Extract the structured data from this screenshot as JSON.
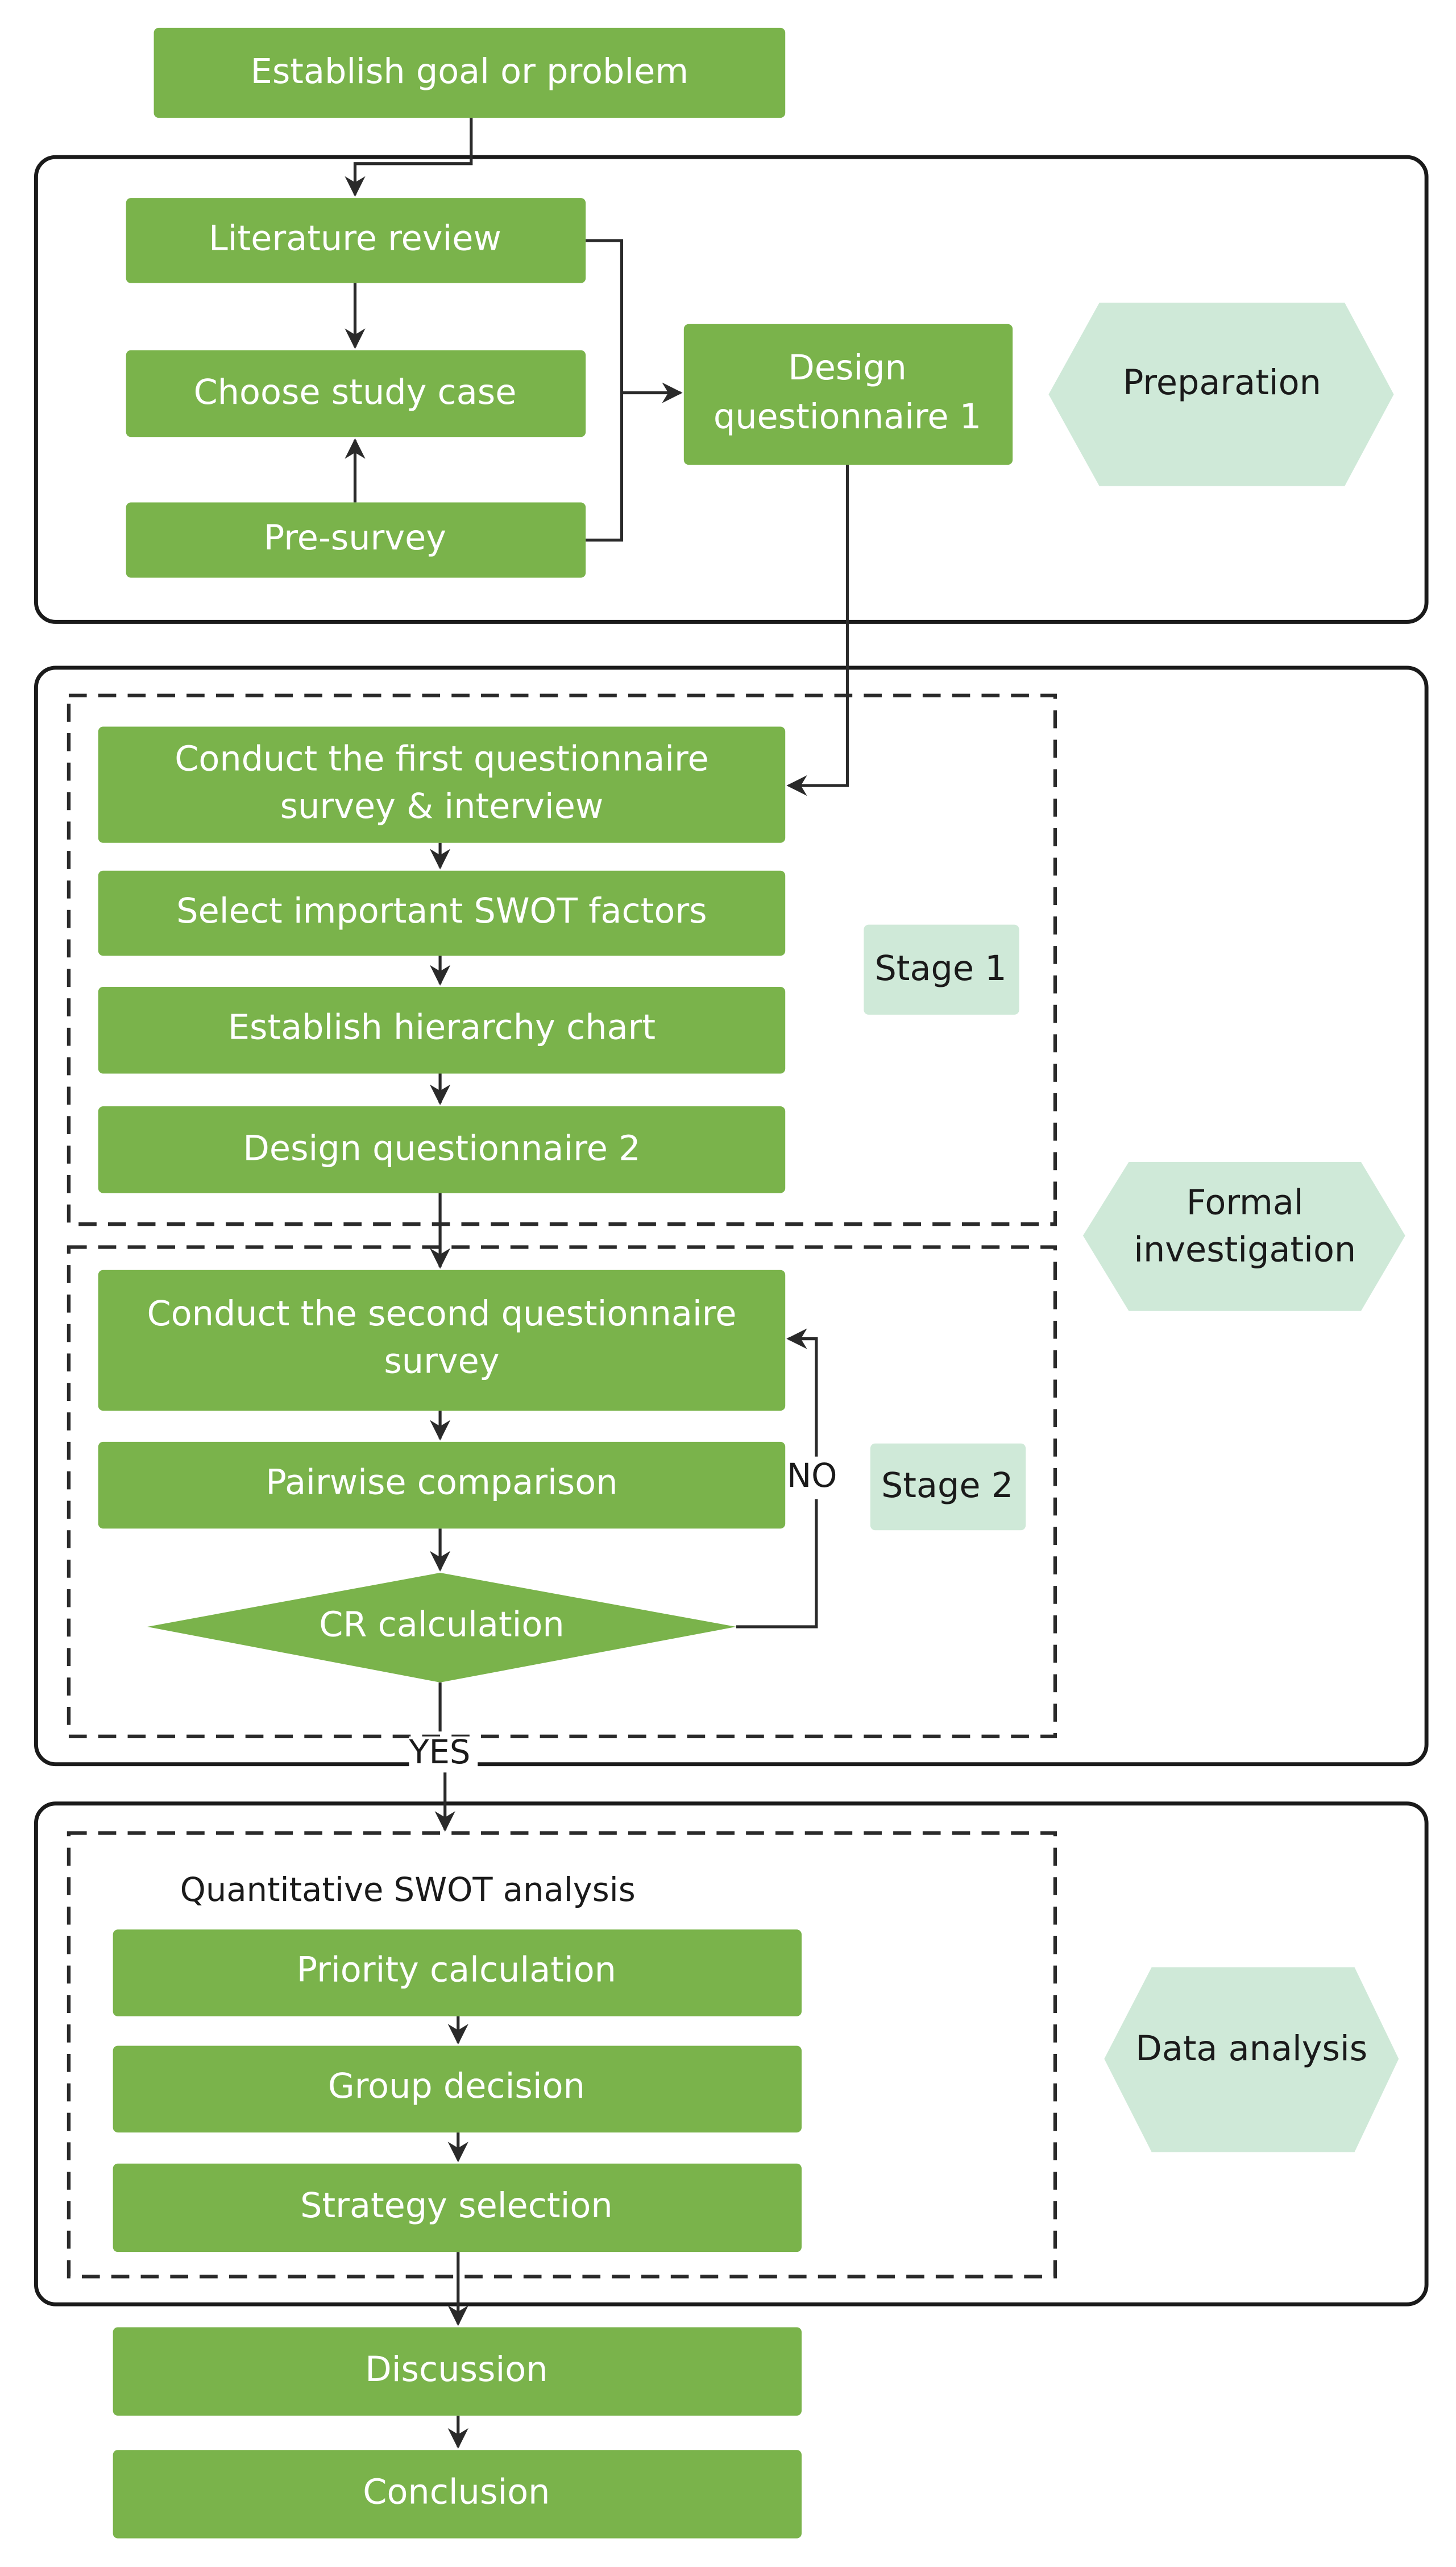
{
  "colors": {
    "process_box": "#7ab34b",
    "phase_label": "#cfe9d8",
    "line": "#2a2a2a",
    "box_text": "#ffffff",
    "label_text": "#1a1a1a"
  },
  "steps": {
    "establish_goal": "Establish goal or problem",
    "literature_review": "Literature review",
    "choose_study_case": "Choose study case",
    "pre_survey": "Pre-survey",
    "design_q1": [
      "Design",
      "questionnaire 1"
    ],
    "conduct_first": [
      "Conduct the first questionnaire",
      "survey & interview"
    ],
    "select_swot": "Select important SWOT factors",
    "hierarchy_chart": "Establish hierarchy chart",
    "design_q2": "Design questionnaire 2",
    "conduct_second": [
      "Conduct the second questionnaire",
      "survey"
    ],
    "pairwise": "Pairwise comparison",
    "cr_calculation": "CR calculation",
    "priority_calc": "Priority calculation",
    "group_decision": "Group decision",
    "strategy_selection": "Strategy selection",
    "discussion": "Discussion",
    "conclusion": "Conclusion"
  },
  "phases": {
    "preparation": [
      "Preparation"
    ],
    "formal_investigation": [
      "Formal",
      "investigation"
    ],
    "data_analysis": [
      "Data analysis"
    ]
  },
  "stages": {
    "stage1": "Stage 1",
    "stage2": "Stage 2",
    "quantitative_title": "Quantitative SWOT analysis"
  },
  "branches": {
    "no": "NO",
    "yes": "YES"
  }
}
